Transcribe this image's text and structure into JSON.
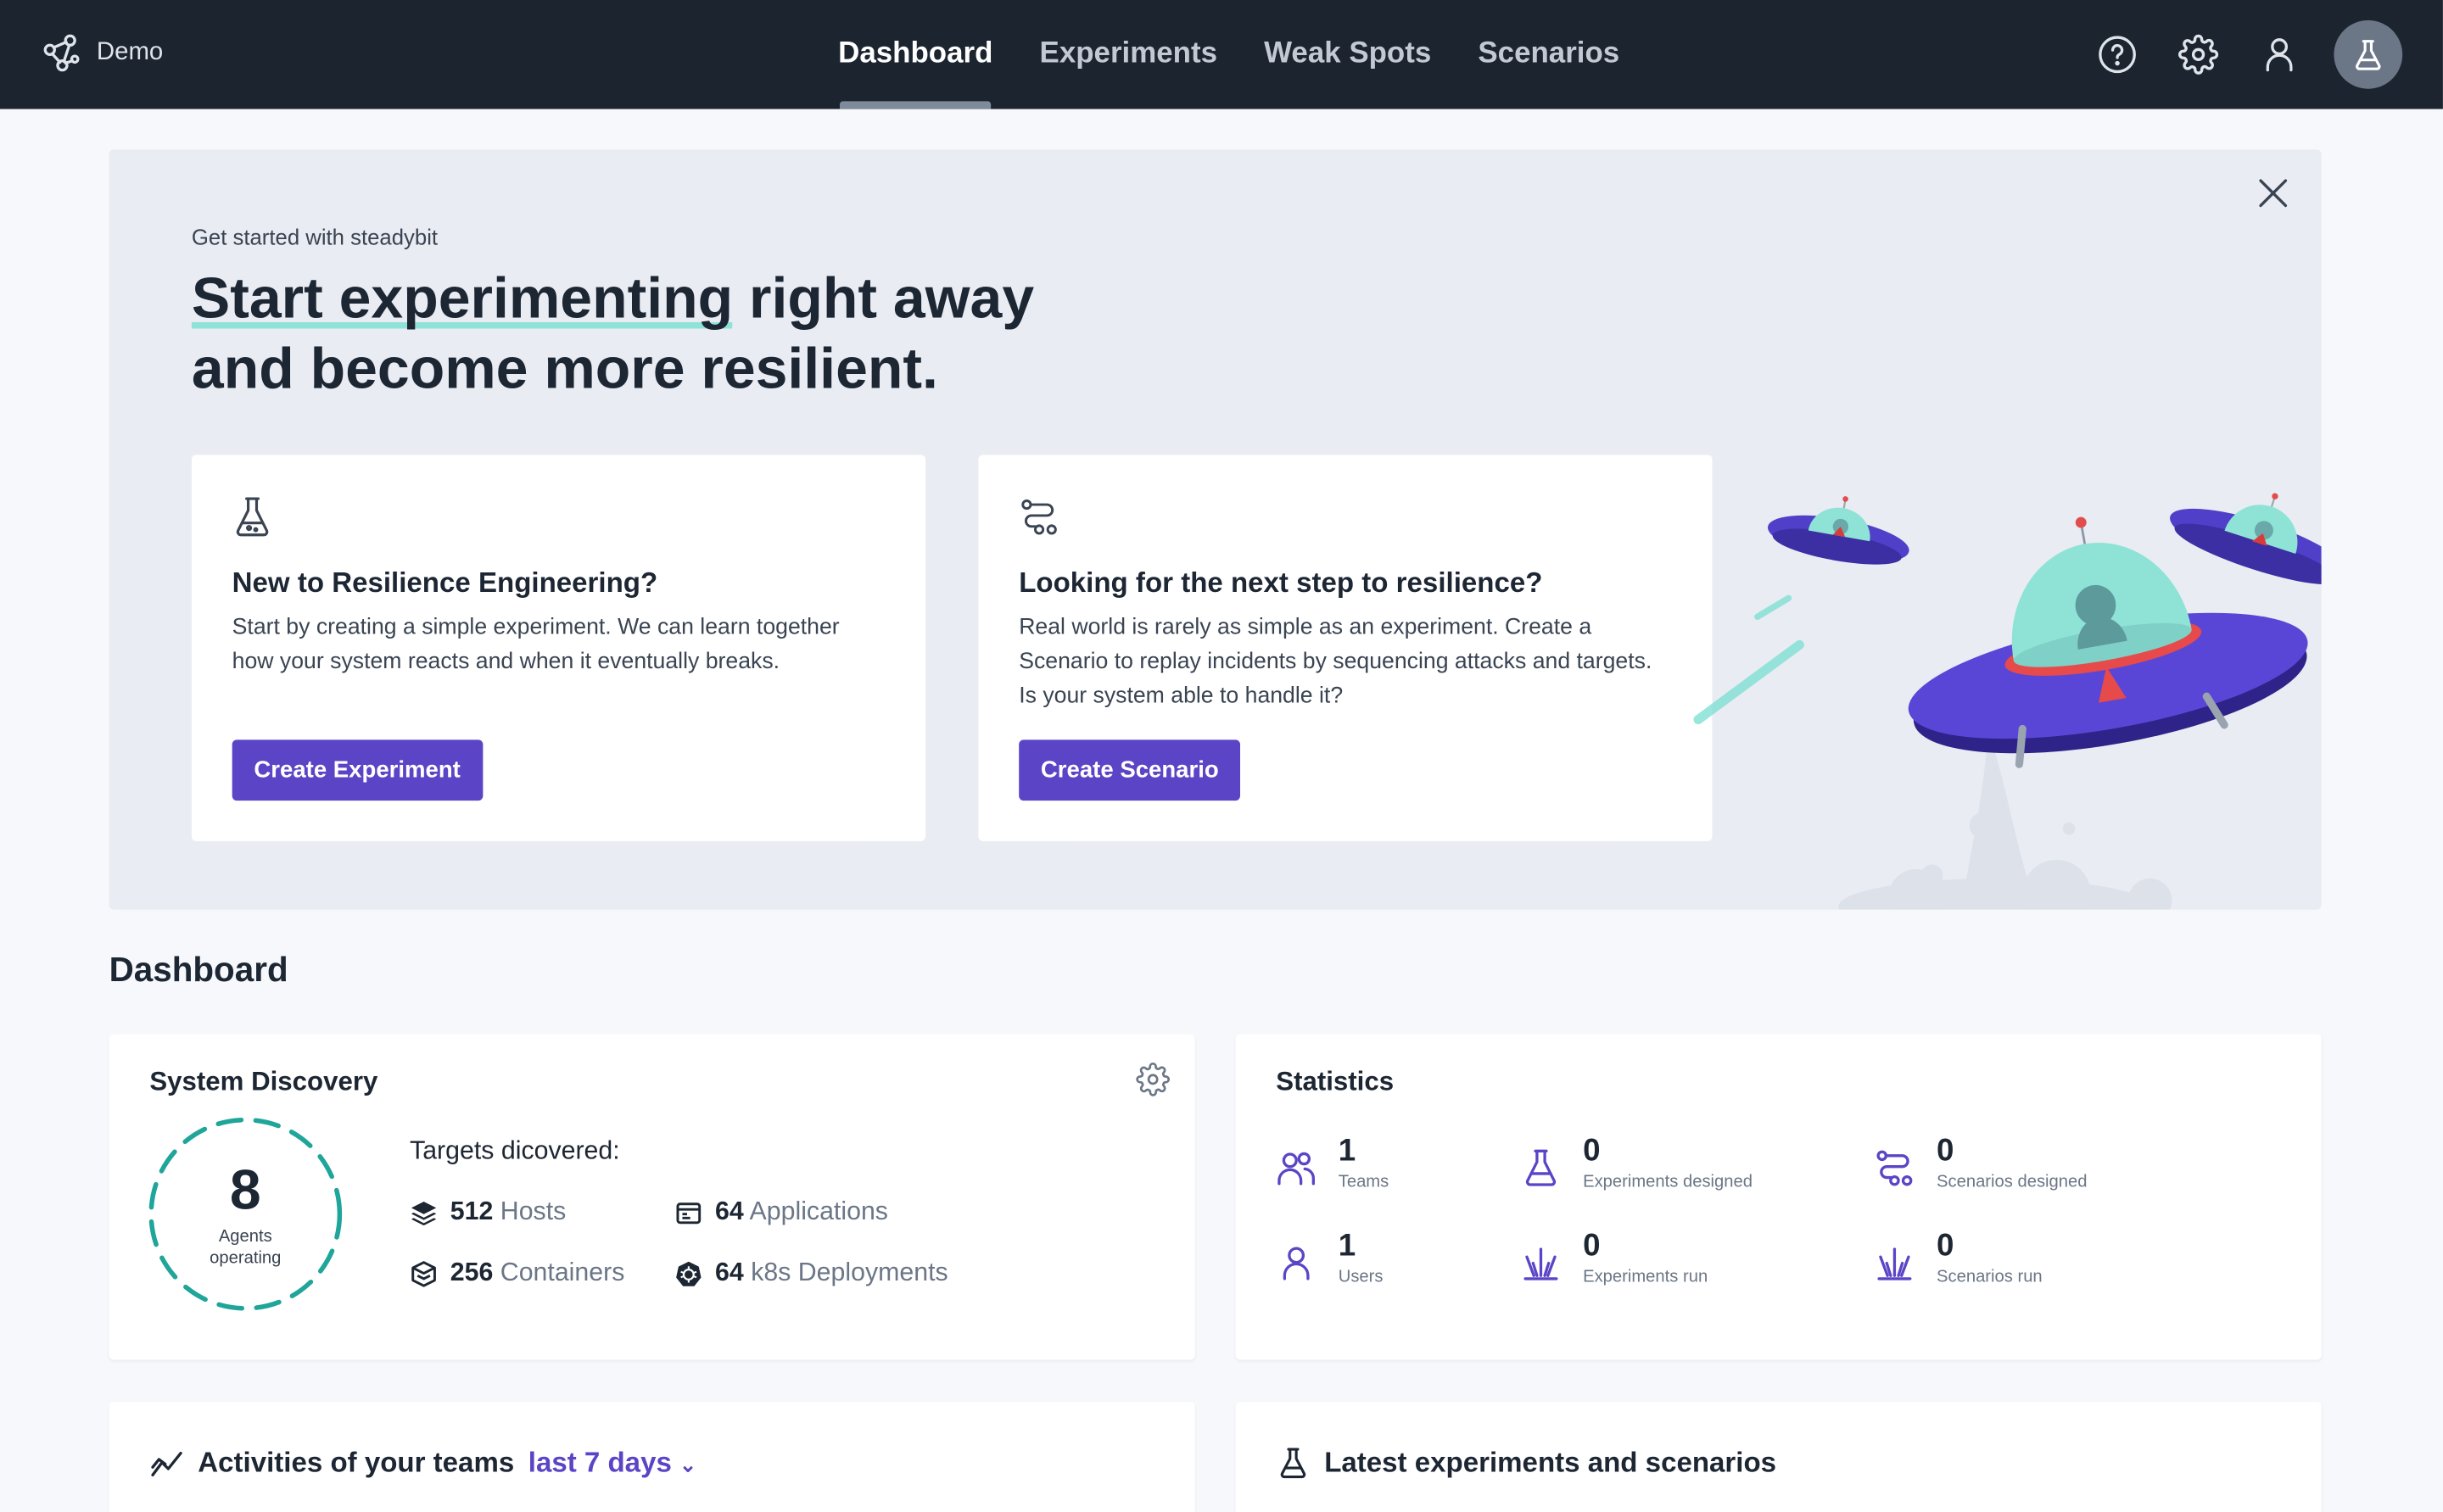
{
  "nav": {
    "brand": "Demo",
    "tabs": [
      {
        "label": "Dashboard",
        "active": true
      },
      {
        "label": "Experiments",
        "active": false
      },
      {
        "label": "Weak Spots",
        "active": false
      },
      {
        "label": "Scenarios",
        "active": false
      }
    ],
    "icons": [
      "help-icon",
      "settings-icon",
      "user-icon",
      "flask-icon"
    ]
  },
  "hero": {
    "eyebrow": "Get started with steadybit",
    "title_highlight": "Start experimenting",
    "title_rest": " right away",
    "title_line2": "and become more resilient.",
    "cards": [
      {
        "icon": "flask-icon",
        "title": "New to Resilience Engineering?",
        "body": "Start by creating a simple experiment. We can learn together how your system reacts and when it eventually breaks.",
        "button": "Create Experiment"
      },
      {
        "icon": "route-icon",
        "title": "Looking for the next step to resilience?",
        "body": "Real world is rarely as simple as an experiment. Create a Scenario to replay incidents by sequencing attacks and targets. Is your system able to handle it?",
        "button": "Create Scenario"
      }
    ]
  },
  "dashboard": {
    "title": "Dashboard",
    "system_discovery": {
      "title": "System Discovery",
      "agents_count": "8",
      "agents_label": "Agents operating",
      "targets_title": "Targets dicovered:",
      "targets": [
        {
          "count": "512",
          "label": "Hosts",
          "icon": "layers-icon"
        },
        {
          "count": "64",
          "label": "Applications",
          "icon": "application-icon"
        },
        {
          "count": "256",
          "label": "Containers",
          "icon": "container-icon"
        },
        {
          "count": "64",
          "label": "k8s Deployments",
          "icon": "kubernetes-icon"
        }
      ]
    },
    "statistics": {
      "title": "Statistics",
      "items": [
        {
          "value": "1",
          "label": "Teams",
          "icon": "teams-icon"
        },
        {
          "value": "0",
          "label": "Experiments designed",
          "icon": "flask-icon"
        },
        {
          "value": "0",
          "label": "Scenarios designed",
          "icon": "route-icon"
        },
        {
          "value": "1",
          "label": "Users",
          "icon": "user-icon"
        },
        {
          "value": "0",
          "label": "Experiments run",
          "icon": "burst-icon"
        },
        {
          "value": "0",
          "label": "Scenarios run",
          "icon": "burst-icon"
        }
      ]
    },
    "activities": {
      "title": "Activities of your teams",
      "period": "last 7 days"
    },
    "latest": {
      "title": "Latest experiments and scenarios"
    }
  },
  "colors": {
    "navbar": "#1c2430",
    "accent": "#5b45c6",
    "highlight": "#8ee3d6",
    "agents_ring": "#1fa59a",
    "hero_bg": "#e9ecf2"
  }
}
